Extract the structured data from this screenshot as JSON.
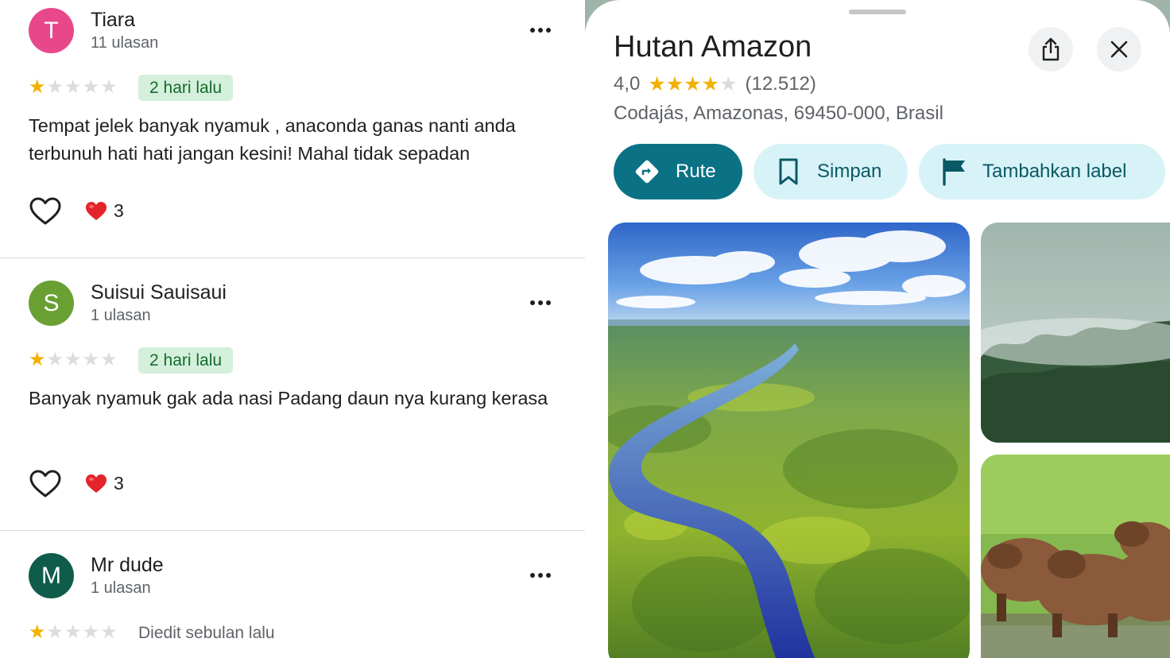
{
  "reviews": [
    {
      "avatar_letter": "T",
      "avatar_color": "#e8488a",
      "name": "Tiara",
      "review_count": "11 ulasan",
      "rating": 1,
      "date": "2 hari lalu",
      "text": "Tempat jelek banyak nyamuk , anaconda ganas nanti anda terbunuh hati hati jangan kesini! Mahal tidak sepadan",
      "reaction_count": "3"
    },
    {
      "avatar_letter": "S",
      "avatar_color": "#6aa033",
      "name": "Suisui Sauisaui",
      "review_count": "1 ulasan",
      "rating": 1,
      "date": "2 hari lalu",
      "text": "Banyak nyamuk gak ada nasi Padang daun nya kurang kerasa",
      "reaction_count": "3"
    },
    {
      "avatar_letter": "M",
      "avatar_color": "#0f5c4a",
      "name": "Mr dude",
      "review_count": "1 ulasan",
      "rating": 1,
      "date": "Diedit sebulan lalu"
    }
  ],
  "place": {
    "title": "Hutan Amazon",
    "rating_value": "4,0",
    "rating_stars": 4,
    "rating_count": "(12.512)",
    "address": "Codajás, Amazonas, 69450-000, Brasil",
    "actions": {
      "route": "Rute",
      "save": "Simpan",
      "label": "Tambahkan label"
    },
    "accent_color": "#0b7285"
  }
}
